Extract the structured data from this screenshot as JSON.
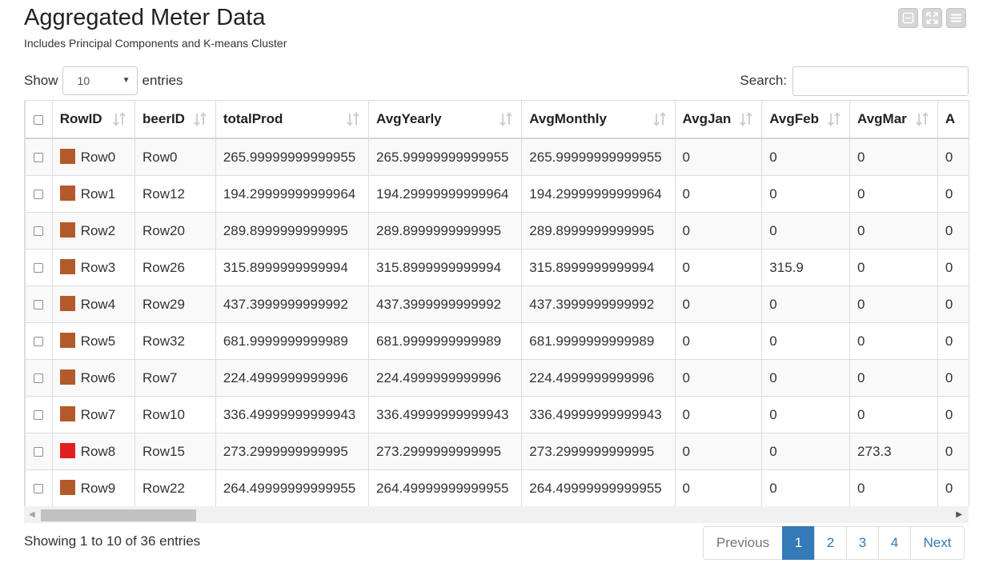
{
  "header": {
    "title": "Aggregated Meter Data",
    "subtitle": "Includes Principal Components and K-means Cluster",
    "tools": [
      {
        "name": "collapse-icon"
      },
      {
        "name": "expand-icon"
      },
      {
        "name": "menu-icon"
      }
    ]
  },
  "length": {
    "show_label": "Show",
    "selected": "10",
    "entries_label": "entries"
  },
  "search": {
    "label": "Search:",
    "value": "",
    "placeholder": ""
  },
  "table": {
    "columns": [
      "RowID",
      "beerID",
      "totalProd",
      "AvgYearly",
      "AvgMonthly",
      "AvgJan",
      "AvgFeb",
      "AvgMar",
      "AvgApr"
    ],
    "partial_header": "A",
    "rows": [
      {
        "color": "#b35a2b",
        "cells": [
          "Row0",
          "Row0",
          "265.99999999999955",
          "265.99999999999955",
          "265.99999999999955",
          "0",
          "0",
          "0",
          "0"
        ]
      },
      {
        "color": "#b35a2b",
        "cells": [
          "Row1",
          "Row12",
          "194.29999999999964",
          "194.29999999999964",
          "194.29999999999964",
          "0",
          "0",
          "0",
          "0"
        ]
      },
      {
        "color": "#b35a2b",
        "cells": [
          "Row2",
          "Row20",
          "289.8999999999995",
          "289.8999999999995",
          "289.8999999999995",
          "0",
          "0",
          "0",
          "0"
        ]
      },
      {
        "color": "#b35a2b",
        "cells": [
          "Row3",
          "Row26",
          "315.8999999999994",
          "315.8999999999994",
          "315.8999999999994",
          "0",
          "315.9",
          "0",
          "0"
        ]
      },
      {
        "color": "#b35a2b",
        "cells": [
          "Row4",
          "Row29",
          "437.3999999999992",
          "437.3999999999992",
          "437.3999999999992",
          "0",
          "0",
          "0",
          "0"
        ]
      },
      {
        "color": "#b35a2b",
        "cells": [
          "Row5",
          "Row32",
          "681.9999999999989",
          "681.9999999999989",
          "681.9999999999989",
          "0",
          "0",
          "0",
          "0"
        ]
      },
      {
        "color": "#b35a2b",
        "cells": [
          "Row6",
          "Row7",
          "224.4999999999996",
          "224.4999999999996",
          "224.4999999999996",
          "0",
          "0",
          "0",
          "0"
        ]
      },
      {
        "color": "#b35a2b",
        "cells": [
          "Row7",
          "Row10",
          "336.49999999999943",
          "336.49999999999943",
          "336.49999999999943",
          "0",
          "0",
          "0",
          "0"
        ]
      },
      {
        "color": "#e02020",
        "cells": [
          "Row8",
          "Row15",
          "273.2999999999995",
          "273.2999999999995",
          "273.2999999999995",
          "0",
          "0",
          "273.3",
          "0"
        ]
      },
      {
        "color": "#b35a2b",
        "cells": [
          "Row9",
          "Row22",
          "264.49999999999955",
          "264.49999999999955",
          "264.49999999999955",
          "0",
          "0",
          "0",
          "0"
        ]
      }
    ]
  },
  "footer": {
    "info": "Showing 1 to 10 of 36 entries",
    "pagination": {
      "previous": "Previous",
      "pages": [
        "1",
        "2",
        "3",
        "4"
      ],
      "active": "1",
      "next": "Next"
    }
  },
  "colors": {
    "accent": "#337ab7",
    "cluster_a": "#b35a2b",
    "cluster_b": "#e02020"
  }
}
